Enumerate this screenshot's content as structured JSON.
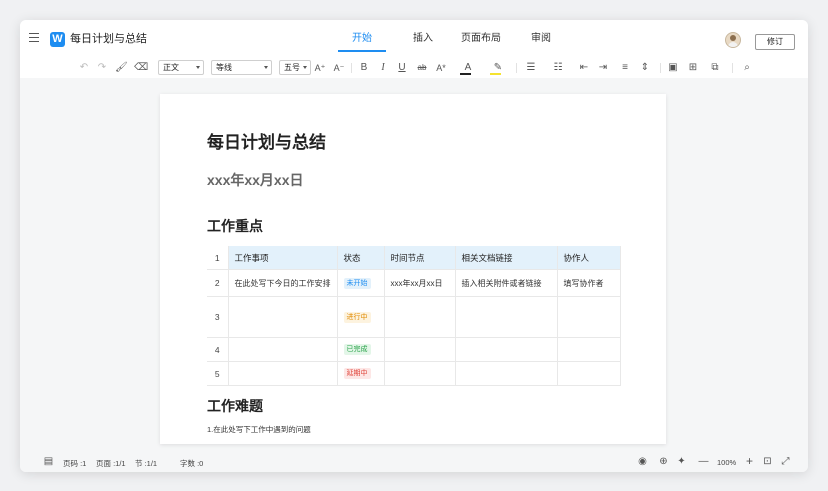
{
  "header": {
    "doc_title": "每日计划与总结",
    "logo_letter": "W",
    "tabs": [
      {
        "label": "开始",
        "active": true
      },
      {
        "label": "插入",
        "active": false
      },
      {
        "label": "页面布局",
        "active": false
      },
      {
        "label": "审阅",
        "active": false
      }
    ],
    "revise_label": "修订"
  },
  "toolbar": {
    "style_select": "正文",
    "font_select": "等线",
    "size_select": "五号",
    "font_color": "#222222",
    "highlight_color": "#f5e330"
  },
  "document": {
    "title": "每日计划与总结",
    "date": "xxx年xx月xx日",
    "section1_heading": "工作重点",
    "table": {
      "headers": [
        "工作事项",
        "状态",
        "时间节点",
        "相关文档链接",
        "协作人"
      ],
      "row_numbers": [
        "1",
        "2",
        "3",
        "4",
        "5"
      ],
      "rows": [
        {
          "item": "在此处写下今日的工作安排",
          "status": "未开始",
          "time": "xxx年xx月xx日",
          "link": "插入相关附件或者链接",
          "person": "填写协作者"
        },
        {
          "item": "",
          "status": "进行中",
          "time": "",
          "link": "",
          "person": ""
        },
        {
          "item": "",
          "status": "已完成",
          "time": "",
          "link": "",
          "person": ""
        },
        {
          "item": "",
          "status": "延期中",
          "time": "",
          "link": "",
          "person": ""
        }
      ],
      "status_colors": {
        "未开始": {
          "fg": "#1e8df1",
          "bg": "#e3f1fb"
        },
        "进行中": {
          "fg": "#e08a00",
          "bg": "#fdf3df"
        },
        "已完成": {
          "fg": "#2aa34a",
          "bg": "#e3f6e8"
        },
        "延期中": {
          "fg": "#e0443a",
          "bg": "#fde7e6"
        }
      }
    },
    "section2_heading": "工作难题",
    "section2_body": "1.在此处写下工作中遇到的问题"
  },
  "statusbar": {
    "page_code": "页码 :1",
    "page_count": "页面 :1/1",
    "section": "节 :1/1",
    "word_count": "字数 :0",
    "zoom": "100%"
  }
}
